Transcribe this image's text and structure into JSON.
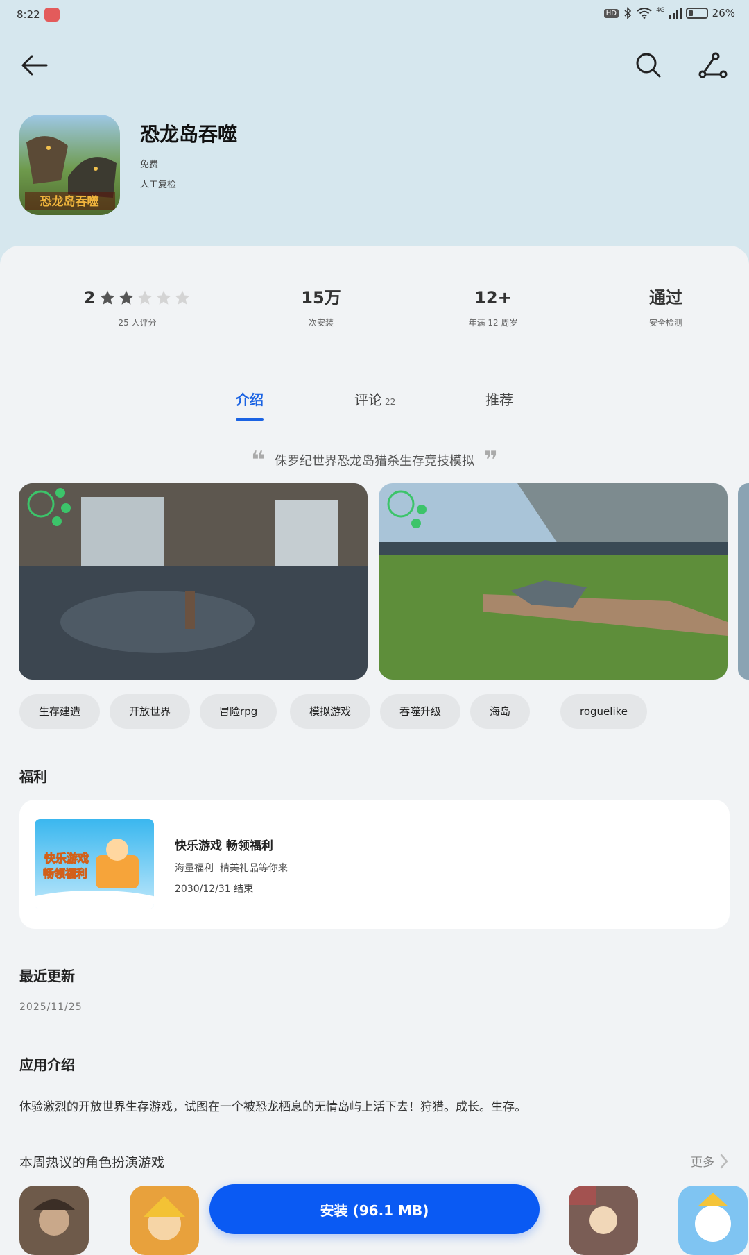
{
  "status_bar": {
    "time": "8:22",
    "network": "4G",
    "battery": "26%",
    "battery_level": 0.26,
    "hd_badge": "HD"
  },
  "app": {
    "title": "恐龙岛吞噬",
    "price": "免费",
    "review_note": "人工复检",
    "icon_caption": "恐龙岛吞噬"
  },
  "stats": {
    "rating": {
      "value": "2",
      "stars": 2,
      "max_stars": 5,
      "sub": "25 人评分"
    },
    "installs": {
      "value": "15万",
      "sub": "次安装"
    },
    "age": {
      "value": "12+",
      "sub": "年满 12 周岁"
    },
    "security": {
      "value": "通过",
      "sub": "安全检测"
    }
  },
  "tabs": [
    {
      "label": "介绍",
      "active": true
    },
    {
      "label": "评论",
      "count": "22"
    },
    {
      "label": "推荐"
    }
  ],
  "slogan": "侏罗纪世界恐龙岛猎杀生存竞技模拟",
  "tags": [
    "生存建造",
    "开放世界",
    "冒险rpg",
    "模拟游戏",
    "吞噬升级",
    "海岛",
    "roguelike"
  ],
  "benefits": {
    "section_title": "福利",
    "title": "快乐游戏 畅领福利",
    "desc": "海量福利  精美礼品等你来",
    "end_date": "2030/12/31 结束",
    "image_line1": "快乐游戏",
    "image_line2": "畅领福利"
  },
  "update": {
    "section_title": "最近更新",
    "date": "2025/11/25"
  },
  "intro": {
    "section_title": "应用介绍",
    "text": "体验激烈的开放世界生存游戏，试图在一个被恐龙栖息的无情岛屿上活下去！狩猎。成长。生存。"
  },
  "hot": {
    "title": "本周热议的角色扮演游戏",
    "more": "更多"
  },
  "install_button": "安装 (96.1 MB)",
  "colors": {
    "accent": "#1b63e3",
    "install": "#0a5af3",
    "hero_bg": "#d6e7ee"
  }
}
